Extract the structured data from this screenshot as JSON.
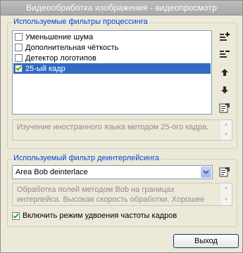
{
  "window": {
    "title": "Видеообработка изображения - видеопросмотр"
  },
  "filters": {
    "group_label": "Используемые фильтры процессинга",
    "items": [
      {
        "label": "Уменьшение шума",
        "checked": false,
        "selected": false
      },
      {
        "label": "Дополнительная чёткость",
        "checked": false,
        "selected": false
      },
      {
        "label": "Детектор логотипов",
        "checked": false,
        "selected": false
      },
      {
        "label": "25-ый кадр",
        "checked": true,
        "selected": true
      }
    ],
    "description": "Изучение иностранного языка методом 25-ого кадра."
  },
  "deinterlace": {
    "group_label": "Используемый фильтр деинтерлейсинга",
    "selected": "Area Bob deinterlace",
    "description_line1": "Обработка полей методом Bob на границах",
    "description_line2": "интерлейса. Высокая скорость обработки. Хорошее"
  },
  "frame_doubling": {
    "label": "Включить режим удвоения частоты кадров",
    "checked": true
  },
  "buttons": {
    "exit": "Выход"
  },
  "icons": [
    "add-filter-icon",
    "remove-filter-icon",
    "move-up-icon",
    "move-down-icon",
    "filter-properties-icon",
    "deinterlace-properties-icon"
  ]
}
